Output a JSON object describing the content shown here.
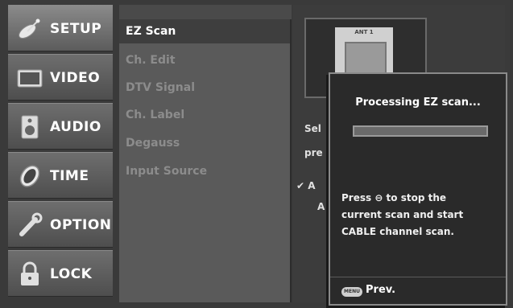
{
  "tabs": [
    {
      "label": "SETUP",
      "icon": "satellite-dish-icon",
      "active": true
    },
    {
      "label": "VIDEO",
      "icon": "tv-screen-icon",
      "active": false
    },
    {
      "label": "AUDIO",
      "icon": "speaker-icon",
      "active": false
    },
    {
      "label": "TIME",
      "icon": "clock-icon",
      "active": false
    },
    {
      "label": "OPTION",
      "icon": "wrench-icon",
      "active": false
    },
    {
      "label": "LOCK",
      "icon": "padlock-icon",
      "active": false
    }
  ],
  "submenu": {
    "items": [
      {
        "label": "EZ Scan",
        "selected": true
      },
      {
        "label": "Ch. Edit",
        "selected": false
      },
      {
        "label": "DTV Signal",
        "selected": false
      },
      {
        "label": "Ch. Label",
        "selected": false
      },
      {
        "label": "Degauss",
        "selected": false
      },
      {
        "label": "Input Source",
        "selected": false
      }
    ]
  },
  "preview": {
    "label": "ANT 1"
  },
  "description": {
    "line1": "Sel",
    "line2": "pre",
    "check": "✔ A",
    "line4": "A"
  },
  "popup": {
    "title": "Processing EZ scan...",
    "progress": 0.0,
    "message_lines": [
      "Press ⊖ to stop the",
      "current scan and start",
      "CABLE channel scan."
    ],
    "menu_button": "MENU",
    "prev_label": "Prev."
  },
  "colors": {
    "background": "#3a3a3a",
    "tab": "#5e5e5e",
    "submenu": "#5a5a5a",
    "popup": "#2a2a2a",
    "text_inactive": "#8c8c8c",
    "text_active": "#ffffff"
  }
}
